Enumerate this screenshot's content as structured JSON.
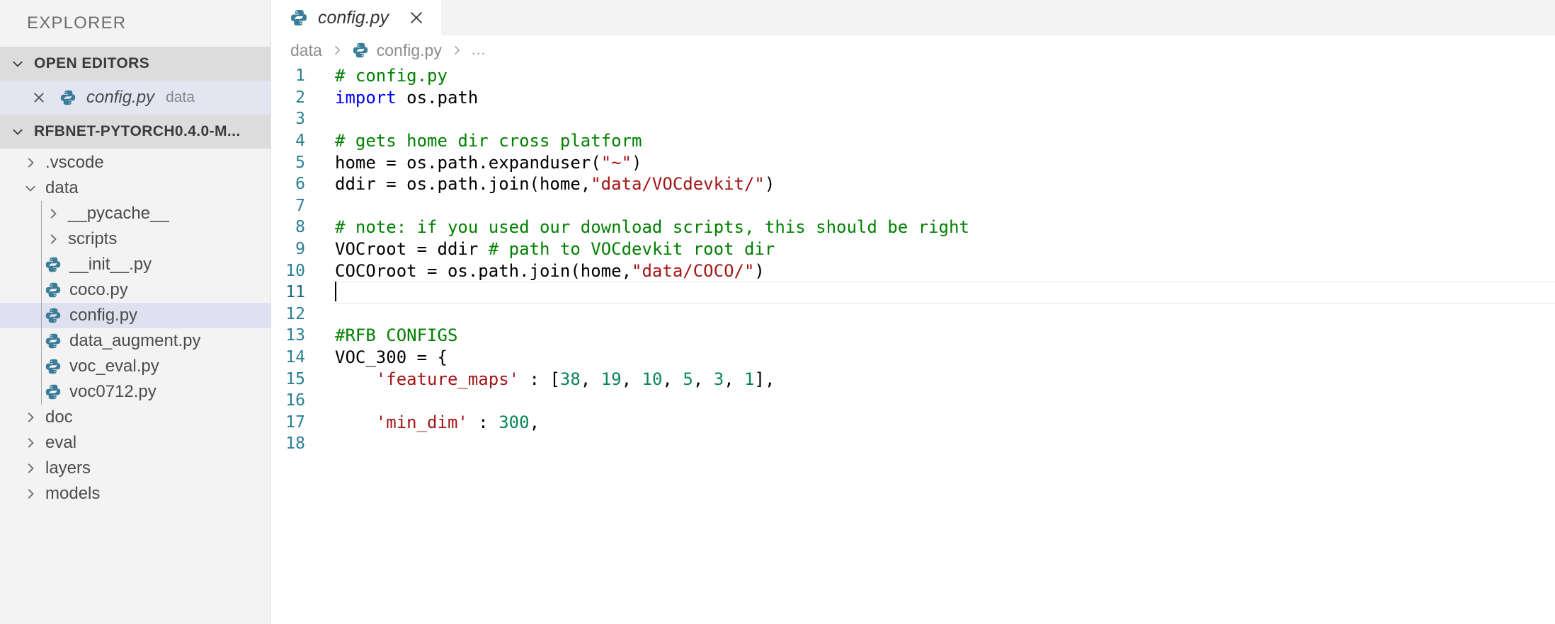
{
  "sidebar": {
    "title": "EXPLORER",
    "open_editors": {
      "label": "OPEN EDITORS",
      "items": [
        {
          "name": "config.py",
          "description": "data",
          "icon": "python-icon",
          "close_icon": "close-icon"
        }
      ]
    },
    "workspace": {
      "label": "RFBNET-PYTORCH0.4.0-M...",
      "items": [
        {
          "label": ".vscode",
          "type": "folder",
          "expanded": false,
          "depth": 1
        },
        {
          "label": "data",
          "type": "folder",
          "expanded": true,
          "depth": 1
        },
        {
          "label": "__pycache__",
          "type": "folder",
          "expanded": false,
          "depth": 2
        },
        {
          "label": "scripts",
          "type": "folder",
          "expanded": false,
          "depth": 2
        },
        {
          "label": "__init__.py",
          "type": "python",
          "depth": 2
        },
        {
          "label": "coco.py",
          "type": "python",
          "depth": 2
        },
        {
          "label": "config.py",
          "type": "python",
          "depth": 2,
          "selected": true
        },
        {
          "label": "data_augment.py",
          "type": "python",
          "depth": 2
        },
        {
          "label": "voc_eval.py",
          "type": "python",
          "depth": 2
        },
        {
          "label": "voc0712.py",
          "type": "python",
          "depth": 2
        },
        {
          "label": "doc",
          "type": "folder",
          "expanded": false,
          "depth": 1
        },
        {
          "label": "eval",
          "type": "folder",
          "expanded": false,
          "depth": 1
        },
        {
          "label": "layers",
          "type": "folder",
          "expanded": false,
          "depth": 1
        },
        {
          "label": "models",
          "type": "folder",
          "expanded": false,
          "depth": 1
        }
      ]
    }
  },
  "tabs": [
    {
      "label": "config.py",
      "icon": "python-icon",
      "close_icon": "close-icon",
      "active": true
    }
  ],
  "breadcrumb": {
    "items": [
      "data",
      "config.py",
      "..."
    ],
    "separator": "›"
  },
  "editor": {
    "language": "python",
    "active_line": 11,
    "lines": [
      {
        "n": 1,
        "tokens": [
          {
            "t": "# config.py",
            "c": "comment"
          }
        ]
      },
      {
        "n": 2,
        "tokens": [
          {
            "t": "import",
            "c": "keyword"
          },
          {
            "t": " os.path",
            "c": "plain"
          }
        ]
      },
      {
        "n": 3,
        "tokens": []
      },
      {
        "n": 4,
        "tokens": [
          {
            "t": "# gets home dir cross platform",
            "c": "comment"
          }
        ]
      },
      {
        "n": 5,
        "tokens": [
          {
            "t": "home = os.path.expanduser(",
            "c": "plain"
          },
          {
            "t": "\"~\"",
            "c": "string"
          },
          {
            "t": ")",
            "c": "plain"
          }
        ]
      },
      {
        "n": 6,
        "tokens": [
          {
            "t": "ddir = os.path.join(home,",
            "c": "plain"
          },
          {
            "t": "\"data/VOCdevkit/\"",
            "c": "string"
          },
          {
            "t": ")",
            "c": "plain"
          }
        ]
      },
      {
        "n": 7,
        "tokens": []
      },
      {
        "n": 8,
        "tokens": [
          {
            "t": "# note: if you used our download scripts, this should be right",
            "c": "comment"
          }
        ]
      },
      {
        "n": 9,
        "tokens": [
          {
            "t": "VOCroot = ddir ",
            "c": "plain"
          },
          {
            "t": "# path to VOCdevkit root dir",
            "c": "comment"
          }
        ]
      },
      {
        "n": 10,
        "tokens": [
          {
            "t": "COCOroot = os.path.join(home,",
            "c": "plain"
          },
          {
            "t": "\"data/COCO/\"",
            "c": "string"
          },
          {
            "t": ")",
            "c": "plain"
          }
        ]
      },
      {
        "n": 11,
        "tokens": [],
        "active": true,
        "cursor": true
      },
      {
        "n": 12,
        "tokens": []
      },
      {
        "n": 13,
        "tokens": [
          {
            "t": "#RFB CONFIGS",
            "c": "comment"
          }
        ]
      },
      {
        "n": 14,
        "tokens": [
          {
            "t": "VOC_300 = {",
            "c": "plain"
          }
        ]
      },
      {
        "n": 15,
        "tokens": [
          {
            "t": "    ",
            "c": "plain"
          },
          {
            "t": "'feature_maps'",
            "c": "string"
          },
          {
            "t": " : [",
            "c": "plain"
          },
          {
            "t": "38",
            "c": "number"
          },
          {
            "t": ", ",
            "c": "plain"
          },
          {
            "t": "19",
            "c": "number"
          },
          {
            "t": ", ",
            "c": "plain"
          },
          {
            "t": "10",
            "c": "number"
          },
          {
            "t": ", ",
            "c": "plain"
          },
          {
            "t": "5",
            "c": "number"
          },
          {
            "t": ", ",
            "c": "plain"
          },
          {
            "t": "3",
            "c": "number"
          },
          {
            "t": ", ",
            "c": "plain"
          },
          {
            "t": "1",
            "c": "number"
          },
          {
            "t": "],",
            "c": "plain"
          }
        ]
      },
      {
        "n": 16,
        "tokens": []
      },
      {
        "n": 17,
        "tokens": [
          {
            "t": "    ",
            "c": "plain"
          },
          {
            "t": "'min_dim'",
            "c": "string"
          },
          {
            "t": " : ",
            "c": "plain"
          },
          {
            "t": "300",
            "c": "number"
          },
          {
            "t": ",",
            "c": "plain"
          }
        ]
      },
      {
        "n": 18,
        "tokens": []
      }
    ]
  },
  "colors": {
    "sidebar_bg": "#f3f3f3",
    "section_header_bg": "#dcdcdc",
    "selection_bg": "#dfe1f0",
    "editor_bg": "#ffffff",
    "comment": "#008000",
    "keyword": "#0000ff",
    "string": "#a31515",
    "number": "#098658",
    "plain": "#000000",
    "line_number": "#2b7f93",
    "python_icon": "#3b7d99"
  },
  "icons": {
    "python": "python-icon",
    "close": "close-icon",
    "chevron_right": "chevron-right-icon",
    "chevron_down": "chevron-down-icon",
    "breadcrumb_separator": "chevron-right-icon"
  }
}
